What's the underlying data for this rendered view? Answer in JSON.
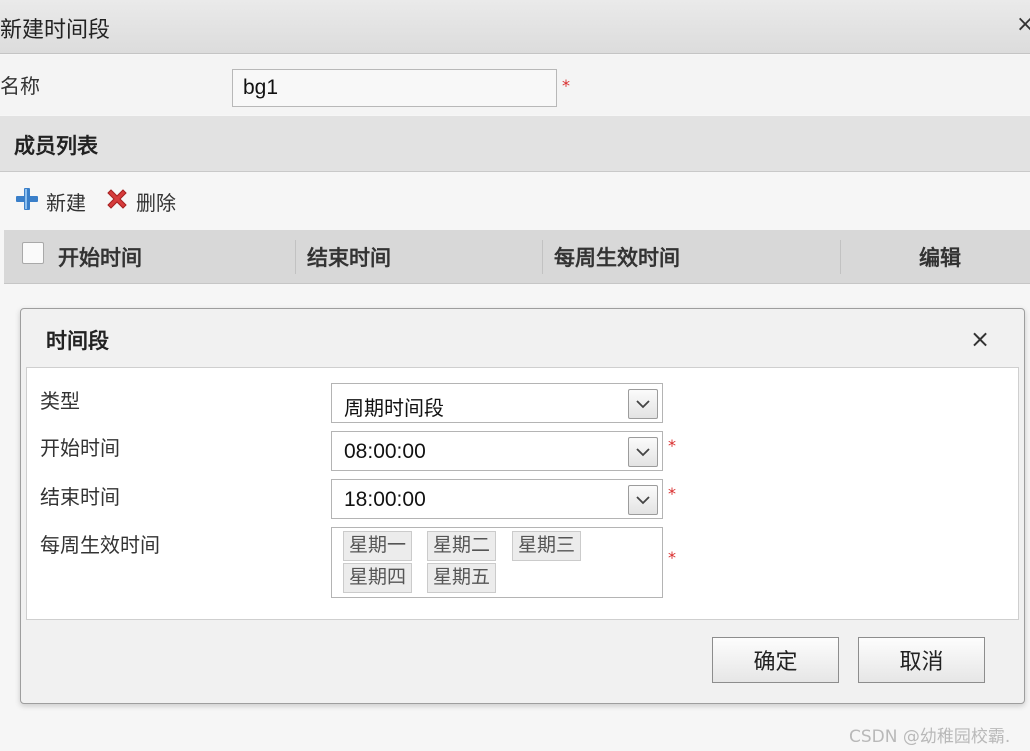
{
  "window": {
    "title": "新建时间段",
    "close_glyph": "×"
  },
  "form": {
    "name_label": "名称",
    "name_value": "bg1",
    "required_mark": "*"
  },
  "members": {
    "section_title": "成员列表",
    "toolbar": {
      "new_label": "新建",
      "delete_label": "删除"
    },
    "columns": [
      "开始时间",
      "结束时间",
      "每周生效时间",
      "编辑"
    ]
  },
  "dialog": {
    "title": "时间段",
    "close_glyph": "×",
    "fields": {
      "type_label": "类型",
      "type_value": "周期时间段",
      "start_label": "开始时间",
      "start_value": "08:00:00",
      "end_label": "结束时间",
      "end_value": "18:00:00",
      "weekdays_label": "每周生效时间",
      "weekdays": [
        "星期一",
        "星期二",
        "星期三",
        "星期四",
        "星期五"
      ]
    },
    "ok_label": "确定",
    "cancel_label": "取消"
  },
  "watermark": "CSDN @幼稚园校霸.",
  "colors": {
    "required": "#d92b2b",
    "add_icon": "#3a7fc9",
    "delete_icon": "#d63b3b"
  },
  "icons": [
    "plus-icon",
    "delete-x-icon",
    "chevron-down-icon",
    "close-icon"
  ]
}
